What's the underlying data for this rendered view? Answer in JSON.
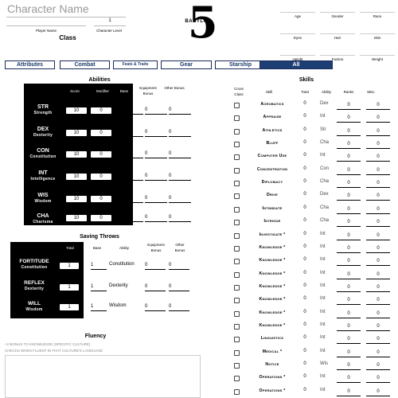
{
  "header": {
    "character_name_placeholder": "Character Name",
    "level_value": "1",
    "player_name_label": "Player Name",
    "level_label": "Character Level",
    "class_label": "Class",
    "logo_text": "BABYLON",
    "logo_number": "5",
    "attributes": [
      "Age",
      "Gender",
      "Race",
      "Eyes",
      "Hair",
      "Skin",
      "Height",
      "Faction",
      "Weight"
    ]
  },
  "tabs": [
    {
      "label": "Attributes"
    },
    {
      "label": "Combat"
    },
    {
      "label": "Feats & Traits"
    },
    {
      "label": "Gear"
    },
    {
      "label": "Starship"
    },
    {
      "label": "All"
    }
  ],
  "abilities": {
    "title": "Abilities",
    "headers": {
      "score": "Score",
      "modifier": "Modifier",
      "base": "Base",
      "equipment": "Equipment Bonus",
      "other": "Other Bonus"
    },
    "rows": [
      {
        "abbr": "STR",
        "full": "Strength",
        "score": "10",
        "modifier": "0",
        "base": "10",
        "equipment": "0",
        "other": "0"
      },
      {
        "abbr": "DEX",
        "full": "Dexterity",
        "score": "10",
        "modifier": "0",
        "base": "10",
        "equipment": "0",
        "other": "0"
      },
      {
        "abbr": "CON",
        "full": "Constitution",
        "score": "10",
        "modifier": "0",
        "base": "10",
        "equipment": "0",
        "other": "0"
      },
      {
        "abbr": "INT",
        "full": "Intelligence",
        "score": "10",
        "modifier": "0",
        "base": "10",
        "equipment": "0",
        "other": "0"
      },
      {
        "abbr": "WIS",
        "full": "Wisdom",
        "score": "10",
        "modifier": "0",
        "base": "10",
        "equipment": "0",
        "other": "0"
      },
      {
        "abbr": "CHA",
        "full": "Charisma",
        "score": "10",
        "modifier": "0",
        "base": "10",
        "equipment": "0",
        "other": "0"
      }
    ]
  },
  "saves": {
    "title": "Saving Throws",
    "headers": {
      "total": "Total",
      "base": "Base",
      "ability": "Ability",
      "equipment": "Equipment Bonus",
      "other": "Other Bonus"
    },
    "rows": [
      {
        "abbr": "FORTITUDE",
        "full": "Constitution",
        "total": "1",
        "base": "1",
        "ability": "Constitution",
        "equipment": "0",
        "other": "0"
      },
      {
        "abbr": "REFLEX",
        "full": "Dexterity",
        "total": "1",
        "base": "1",
        "ability": "Dexterity",
        "equipment": "0",
        "other": "0"
      },
      {
        "abbr": "WILL",
        "full": "Wisdom",
        "total": "1",
        "base": "1",
        "ability": "Wisdom",
        "equipment": "0",
        "other": "0"
      }
    ]
  },
  "fluency": {
    "title": "Fluency",
    "note1": "+2 bonus to Knowledge (specific culture)",
    "note2": "checks when fluent in that culture's language"
  },
  "skills": {
    "title": "Skills",
    "headers": {
      "cross": "Cross Class",
      "skill": "Skill",
      "total": "Total",
      "ability": "Ability",
      "ranks": "Ranks",
      "misc": "Misc"
    },
    "rows": [
      {
        "name": "Acrobatics",
        "total": "0",
        "ability": "Dex",
        "ranks": "0",
        "misc": "0"
      },
      {
        "name": "Appraise",
        "total": "0",
        "ability": "Int",
        "ranks": "0",
        "misc": "0"
      },
      {
        "name": "Athletics",
        "total": "0",
        "ability": "Str",
        "ranks": "0",
        "misc": "0"
      },
      {
        "name": "Bluff",
        "total": "0",
        "ability": "Cha",
        "ranks": "0",
        "misc": "0"
      },
      {
        "name": "Computer Use",
        "total": "0",
        "ability": "Int",
        "ranks": "0",
        "misc": "0"
      },
      {
        "name": "Concentration",
        "total": "0",
        "ability": "Con",
        "ranks": "0",
        "misc": "0"
      },
      {
        "name": "Diplomacy",
        "total": "0",
        "ability": "Cha",
        "ranks": "0",
        "misc": "0"
      },
      {
        "name": "Drive",
        "total": "0",
        "ability": "Dex",
        "ranks": "0",
        "misc": "0"
      },
      {
        "name": "Intimidate",
        "total": "0",
        "ability": "Cha",
        "ranks": "0",
        "misc": "0"
      },
      {
        "name": "Intrigue",
        "total": "0",
        "ability": "Cha",
        "ranks": "0",
        "misc": "0"
      },
      {
        "name": "Investigate *",
        "total": "0",
        "ability": "Int",
        "ranks": "0",
        "misc": "0"
      },
      {
        "name": "Knowledge *",
        "total": "0",
        "ability": "Int",
        "ranks": "0",
        "misc": "0"
      },
      {
        "name": "Knowledge *",
        "total": "0",
        "ability": "Int",
        "ranks": "0",
        "misc": "0"
      },
      {
        "name": "Knowledge *",
        "total": "0",
        "ability": "Int",
        "ranks": "0",
        "misc": "0"
      },
      {
        "name": "Knowledge *",
        "total": "0",
        "ability": "Int",
        "ranks": "0",
        "misc": "0"
      },
      {
        "name": "Knowledge *",
        "total": "0",
        "ability": "Int",
        "ranks": "0",
        "misc": "0"
      },
      {
        "name": "Knowledge *",
        "total": "0",
        "ability": "Int",
        "ranks": "0",
        "misc": "0"
      },
      {
        "name": "Knowledge *",
        "total": "0",
        "ability": "Int",
        "ranks": "0",
        "misc": "0"
      },
      {
        "name": "Linguistics",
        "total": "0",
        "ability": "Int",
        "ranks": "0",
        "misc": "0"
      },
      {
        "name": "Medical *",
        "total": "0",
        "ability": "Int",
        "ranks": "0",
        "misc": "0"
      },
      {
        "name": "Notice",
        "total": "0",
        "ability": "Wis",
        "ranks": "0",
        "misc": "0"
      },
      {
        "name": "Operations *",
        "total": "0",
        "ability": "Int",
        "ranks": "0",
        "misc": "0"
      },
      {
        "name": "Operations *",
        "total": "0",
        "ability": "Int",
        "ranks": "0",
        "misc": "0"
      }
    ]
  },
  "colors": {
    "accent": "#1e3f73",
    "tab_text": "#1a3a6a"
  }
}
